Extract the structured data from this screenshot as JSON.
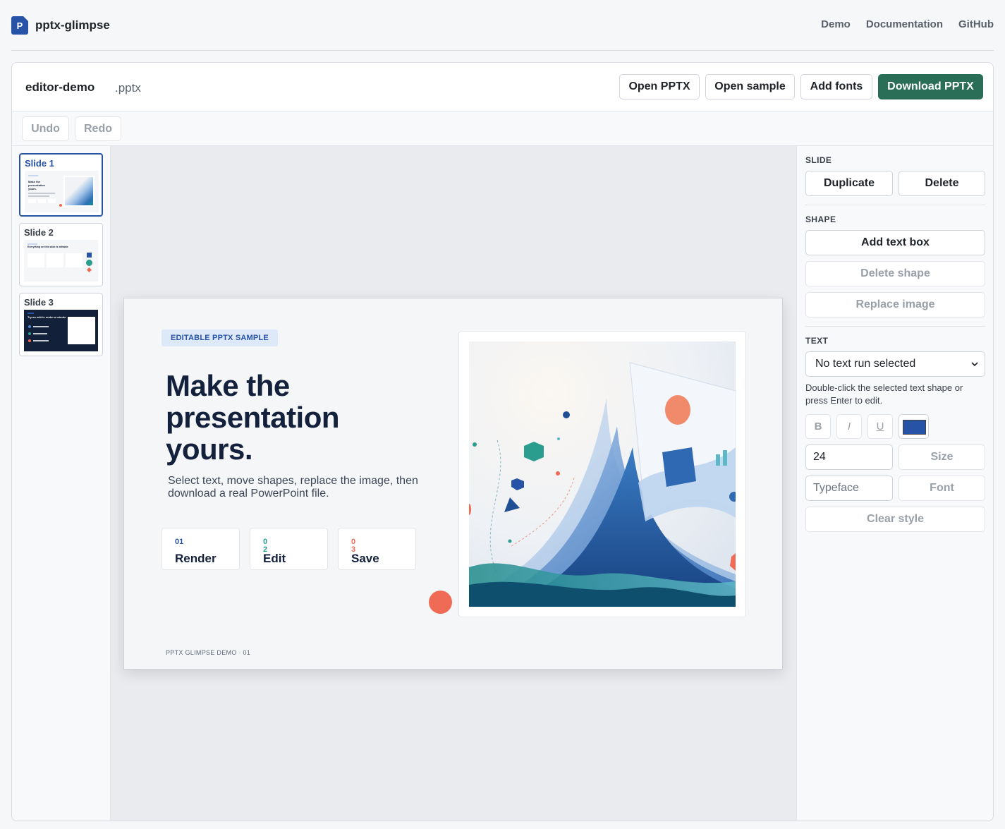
{
  "app": {
    "logo_letter": "P",
    "name": "pptx-glimpse"
  },
  "nav": {
    "demo": "Demo",
    "docs": "Documentation",
    "github": "GitHub"
  },
  "file": {
    "name": "editor-demo",
    "ext": ".pptx"
  },
  "actions": {
    "open": "Open PPTX",
    "sample": "Open sample",
    "fonts": "Add fonts",
    "download": "Download PPTX"
  },
  "history": {
    "undo": "Undo",
    "redo": "Redo"
  },
  "slides": [
    {
      "label": "Slide 1",
      "title": "Make the presentation yours."
    },
    {
      "label": "Slide 2",
      "title": "Everything on this slide is editable"
    },
    {
      "label": "Slide 3",
      "title": "Try an edit in under a minute"
    }
  ],
  "slide": {
    "kicker": "EDITABLE PPTX SAMPLE",
    "headline": "Make the presentation yours.",
    "subtitle": "Select text, move shapes, replace the image, then download a real PowerPoint file.",
    "steps": [
      {
        "num": "01",
        "label": "Render",
        "color": "#2753a6"
      },
      {
        "num": "02",
        "label": "Edit",
        "color": "#2a9d8f"
      },
      {
        "num": "03",
        "label": "Save",
        "color": "#ef6b55"
      }
    ],
    "footer": "PPTX GLIMPSE DEMO  ·  01"
  },
  "panel": {
    "slide_title": "SLIDE",
    "duplicate": "Duplicate",
    "delete": "Delete",
    "shape_title": "SHAPE",
    "add_text_box": "Add text box",
    "delete_shape": "Delete shape",
    "replace_image": "Replace image",
    "text_title": "TEXT",
    "text_run": "No text run selected",
    "hint": "Double-click the selected text shape or press Enter to edit.",
    "bold": "B",
    "italic": "I",
    "underline": "U",
    "color": "#2753a6",
    "size_value": "24",
    "size_btn": "Size",
    "typeface_placeholder": "Typeface",
    "font_btn": "Font",
    "clear_style": "Clear style"
  },
  "colors": {
    "brand": "#2753a6",
    "primary_button": "#2a6e57",
    "accent_orange": "#ef6b55",
    "accent_teal": "#2a9d8f"
  }
}
